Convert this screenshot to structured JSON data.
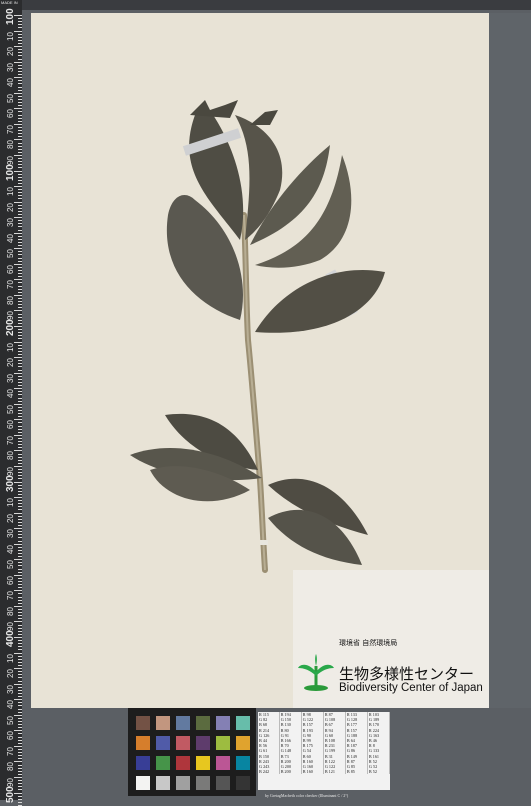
{
  "ruler": {
    "marks": [
      "100",
      "10",
      "20",
      "30",
      "40",
      "50",
      "60",
      "70",
      "80",
      "90",
      "100",
      "10",
      "20",
      "30",
      "40",
      "50",
      "60",
      "70",
      "80",
      "90",
      "200",
      "10",
      "20",
      "30",
      "40",
      "50",
      "60",
      "70",
      "80",
      "90",
      "300",
      "10",
      "20",
      "30",
      "40",
      "50",
      "60",
      "70",
      "80",
      "90",
      "400",
      "10",
      "20",
      "30",
      "40",
      "50",
      "60",
      "70",
      "80",
      "90",
      "500",
      "10"
    ],
    "corner_text": "MADE IN"
  },
  "label": {
    "jp_agency": "環境省 自然環境局",
    "jp_center": "生物多様性センター",
    "en_center": "Biodiversity Center of Japan"
  },
  "color_checker": {
    "swatches": [
      "#735245",
      "#c2967f",
      "#627aa0",
      "#5b6b3f",
      "#8480b4",
      "#67bdaa",
      "#d67e2c",
      "#505ba8",
      "#c15a63",
      "#5e3c6c",
      "#9dbc40",
      "#e0a32e",
      "#383e96",
      "#469449",
      "#af363c",
      "#e7c71f",
      "#bb5695",
      "#0885a1",
      "#f3f3f2",
      "#c8c8c8",
      "#a0a0a0",
      "#7a7a79",
      "#555555",
      "#343434"
    ]
  },
  "value_table": {
    "rows": [
      [
        "R 115",
        "R 194",
        "R 98",
        "R 87",
        "R 133",
        "R 103"
      ],
      [
        "G 82",
        "G 150",
        "G 122",
        "G 108",
        "G 128",
        "G 189"
      ],
      [
        "B 68",
        "B 130",
        "B 157",
        "B 67",
        "B 177",
        "B 170"
      ],
      [
        "R 214",
        "R 80",
        "R 193",
        "R 94",
        "R 157",
        "R 224"
      ],
      [
        "G 126",
        "G 91",
        "G 90",
        "G 60",
        "G 188",
        "G 163"
      ],
      [
        "B 44",
        "B 166",
        "B 99",
        "B 108",
        "B 64",
        "B 46"
      ],
      [
        "R 56",
        "R 70",
        "R 175",
        "R 231",
        "R 187",
        "R 8"
      ],
      [
        "G 61",
        "G 148",
        "G 54",
        "G 199",
        "G 86",
        "G 133"
      ],
      [
        "B 150",
        "B 73",
        "B 60",
        "B 31",
        "B 149",
        "B 161"
      ],
      [
        "R 243",
        "R 200",
        "R 160",
        "R 122",
        "R 87",
        "R 52"
      ],
      [
        "G 243",
        "G 200",
        "G 160",
        "G 122",
        "G 85",
        "G 52"
      ],
      [
        "B 242",
        "B 200",
        "B 160",
        "B 121",
        "B 85",
        "B 52"
      ]
    ],
    "caption": "by GretagMacbeth color checker (Illuminant C / 2°)"
  }
}
